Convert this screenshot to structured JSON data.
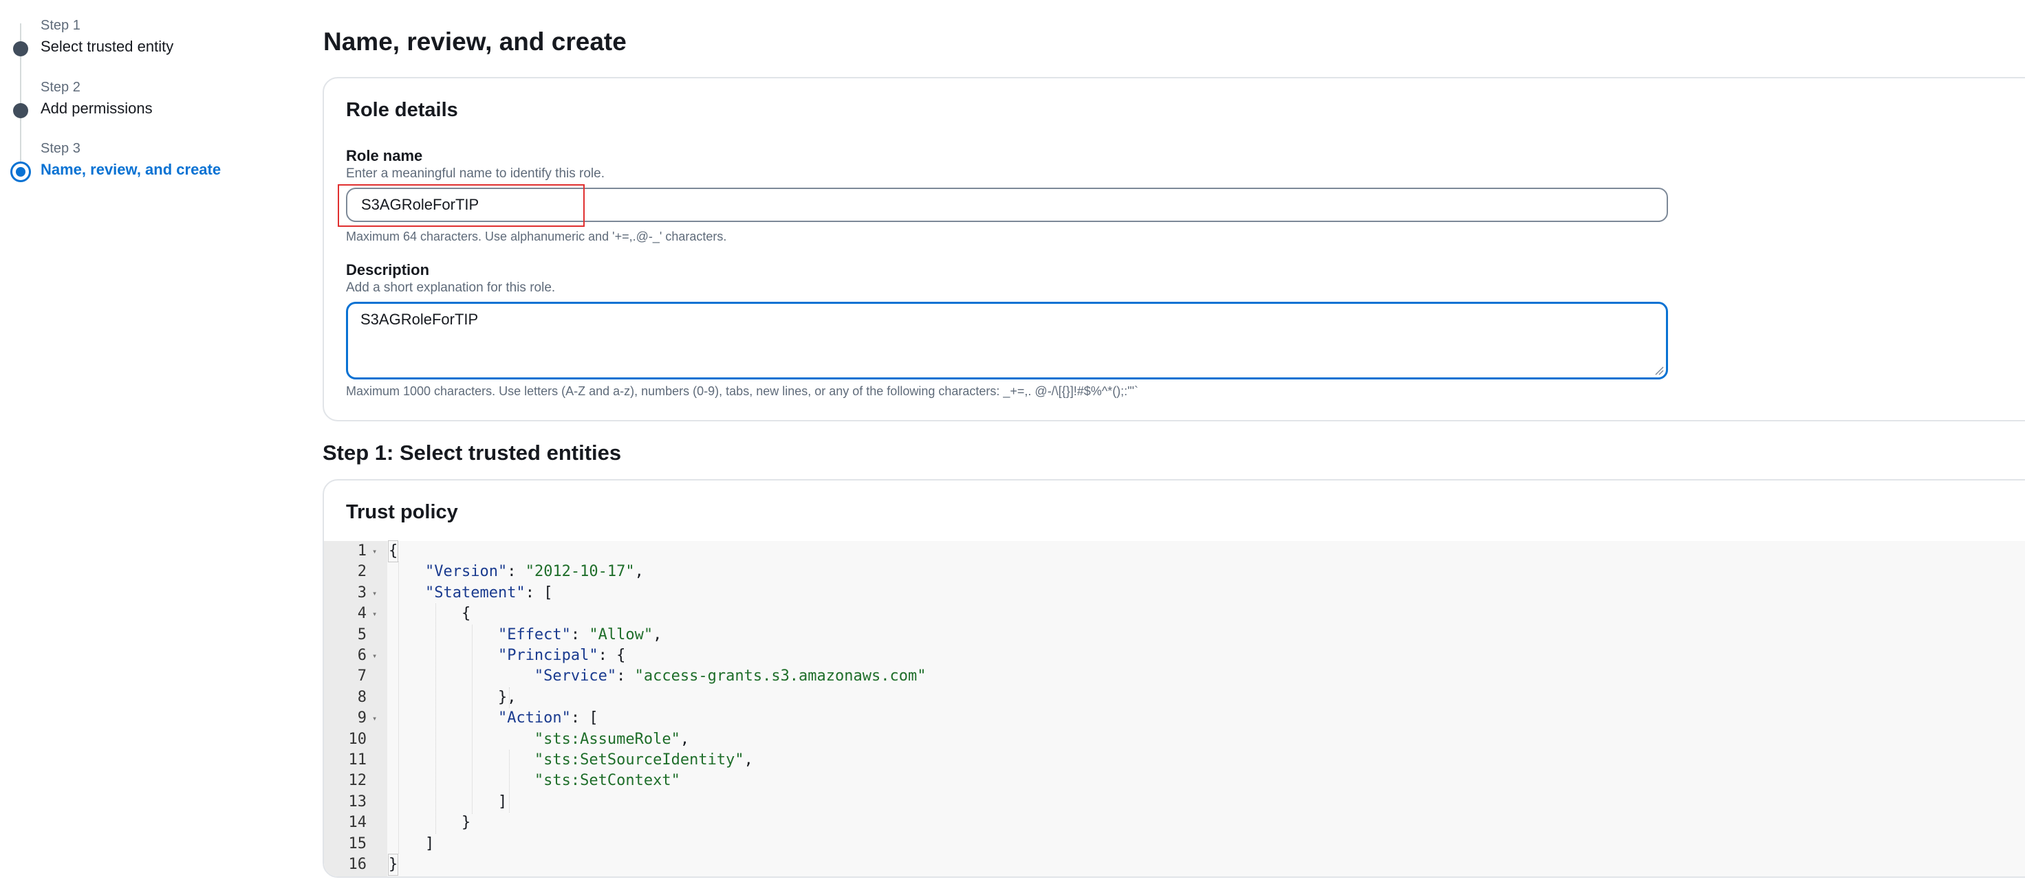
{
  "wizard": {
    "steps": [
      {
        "num": "Step 1",
        "title": "Select trusted entity"
      },
      {
        "num": "Step 2",
        "title": "Add permissions"
      },
      {
        "num": "Step 3",
        "title": "Name, review, and create"
      }
    ]
  },
  "page": {
    "title": "Name, review, and create"
  },
  "role_details": {
    "header": "Role details",
    "role_name": {
      "label": "Role name",
      "description": "Enter a meaningful name to identify this role.",
      "value": "S3AGRoleForTIP",
      "constraint": "Maximum 64 characters. Use alphanumeric and '+=,.@-_' characters."
    },
    "description": {
      "label": "Description",
      "description": "Add a short explanation for this role.",
      "value": "S3AGRoleForTIP",
      "constraint": "Maximum 1000 characters. Use letters (A-Z and a-z), numbers (0-9), tabs, new lines, or any of the following characters: _+=,. @-/\\[{}]!#$%^*();:\"'`"
    }
  },
  "step1": {
    "heading": "Step 1: Select trusted entities",
    "panel_header": "Trust policy",
    "code_lines": [
      {
        "n": "1",
        "fold": true
      },
      {
        "n": "2",
        "fold": false
      },
      {
        "n": "3",
        "fold": true
      },
      {
        "n": "4",
        "fold": true
      },
      {
        "n": "5",
        "fold": false
      },
      {
        "n": "6",
        "fold": true
      },
      {
        "n": "7",
        "fold": false
      },
      {
        "n": "8",
        "fold": false
      },
      {
        "n": "9",
        "fold": true
      },
      {
        "n": "10",
        "fold": false
      },
      {
        "n": "11",
        "fold": false
      },
      {
        "n": "12",
        "fold": false
      },
      {
        "n": "13",
        "fold": false
      },
      {
        "n": "14",
        "fold": false
      },
      {
        "n": "15",
        "fold": false
      },
      {
        "n": "16",
        "fold": false
      }
    ],
    "code": {
      "open_brace": "{",
      "version_key": "\"Version\"",
      "version_val": "\"2012-10-17\"",
      "statement_key": "\"Statement\"",
      "open_bracket": "[",
      "inner_open": "{",
      "effect_key": "\"Effect\"",
      "effect_val": "\"Allow\"",
      "principal_key": "\"Principal\"",
      "principal_open": "{",
      "service_key": "\"Service\"",
      "service_val": "\"access-grants.s3.amazonaws.com\"",
      "principal_close": "},",
      "action_key": "\"Action\"",
      "action_open": "[",
      "action_1": "\"sts:AssumeRole\"",
      "action_2": "\"sts:SetSourceIdentity\"",
      "action_3": "\"sts:SetContext\"",
      "action_close": "]",
      "inner_close": "}",
      "close_bracket": "]",
      "close_brace": "}"
    },
    "fold_glyph": "▾"
  }
}
